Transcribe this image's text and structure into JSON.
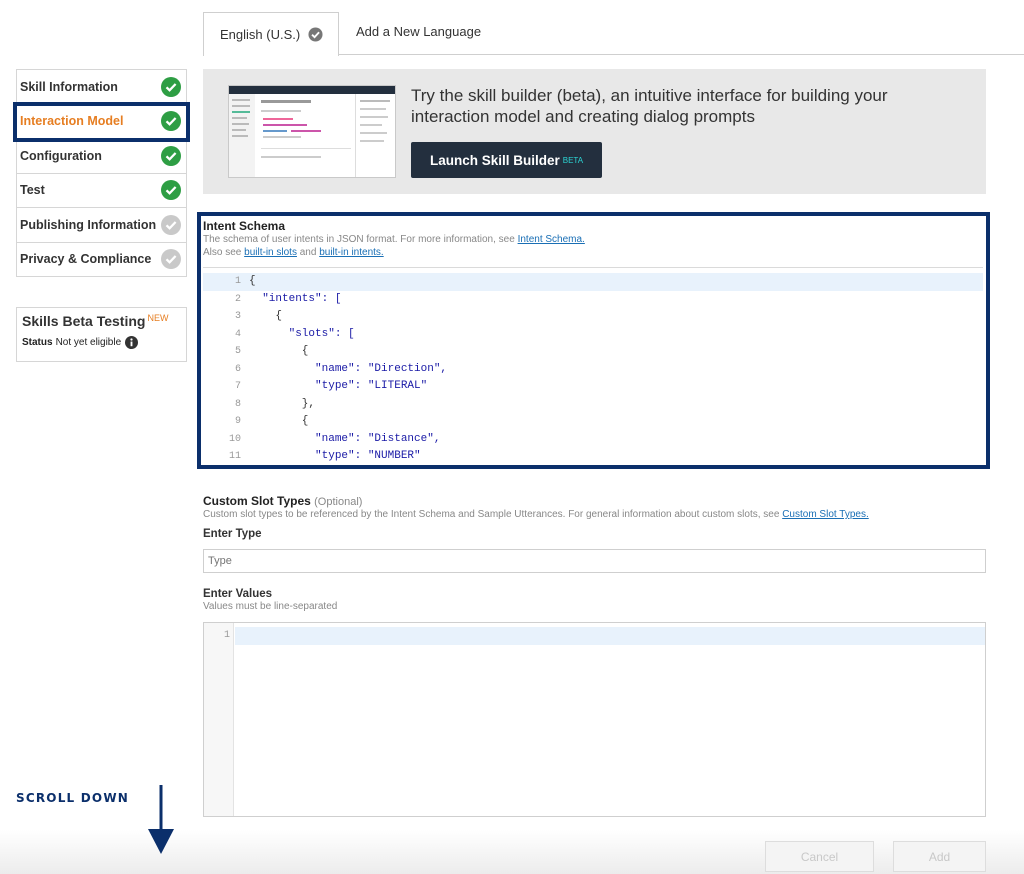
{
  "tabs": {
    "active_label": "English (U.S.)",
    "add_label": "Add a New Language"
  },
  "sidebar": {
    "items": [
      {
        "label": "Skill Information",
        "status": "complete"
      },
      {
        "label": "Interaction Model",
        "status": "complete"
      },
      {
        "label": "Configuration",
        "status": "complete"
      },
      {
        "label": "Test",
        "status": "complete"
      },
      {
        "label": "Publishing Information",
        "status": "incomplete"
      },
      {
        "label": "Privacy & Compliance",
        "status": "incomplete"
      }
    ]
  },
  "beta_testing": {
    "title": "Skills Beta Testing",
    "new_badge": "NEW",
    "status_label": "Status",
    "status_value": "Not yet eligible"
  },
  "banner": {
    "text": "Try the skill builder (beta), an intuitive interface for building your interaction model and creating dialog prompts",
    "button_label": "Launch Skill Builder",
    "button_badge": "BETA"
  },
  "intent_schema": {
    "title": "Intent Schema",
    "desc_prefix": "The schema of user intents in JSON format. For more information, see ",
    "desc_link": "Intent Schema.",
    "also_prefix": "Also see ",
    "slots_link": "built-in slots",
    "and_text": " and ",
    "intents_link": "built-in intents.",
    "lines": [
      {
        "n": "1",
        "text": "{"
      },
      {
        "n": "2",
        "text": "  \"intents\": ["
      },
      {
        "n": "3",
        "text": "    {"
      },
      {
        "n": "4",
        "text": "      \"slots\": ["
      },
      {
        "n": "5",
        "text": "        {"
      },
      {
        "n": "6",
        "text": "          \"name\": \"Direction\","
      },
      {
        "n": "7",
        "text": "          \"type\": \"LITERAL\""
      },
      {
        "n": "8",
        "text": "        },"
      },
      {
        "n": "9",
        "text": "        {"
      },
      {
        "n": "10",
        "text": "          \"name\": \"Distance\","
      },
      {
        "n": "11",
        "text": "          \"type\": \"NUMBER\""
      }
    ]
  },
  "custom_slots": {
    "title": "Custom Slot Types",
    "optional": "(Optional)",
    "desc_prefix": "Custom slot types to be referenced by the Intent Schema and Sample Utterances. For general information about custom slots, see ",
    "desc_link": "Custom Slot Types.",
    "type_label": "Enter Type",
    "type_placeholder": "Type",
    "values_label": "Enter Values",
    "values_hint": "Values must be line-separated",
    "values_line_number": "1"
  },
  "actions": {
    "cancel_label": "Cancel",
    "add_label": "Add"
  },
  "annotation": {
    "scroll_text": "SCROLL DOWN"
  },
  "colors": {
    "complete": "#2e9e44",
    "incomplete": "#c9c9c9",
    "active_item": "#e67e22",
    "highlight": "#0b2f6b",
    "link": "#1a6fb5"
  }
}
